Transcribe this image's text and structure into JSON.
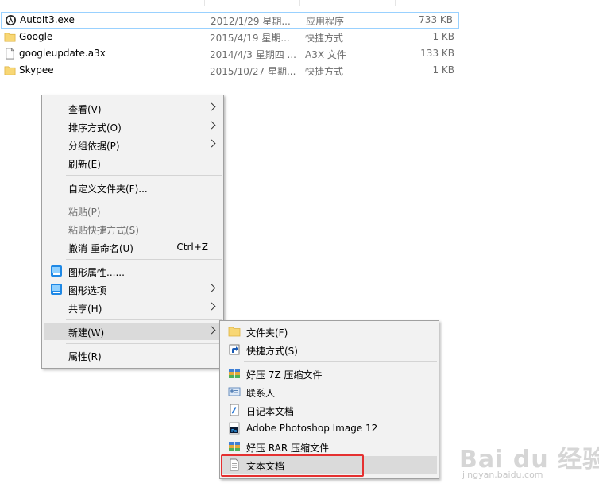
{
  "files": [
    {
      "name": "AutoIt3.exe",
      "date": "2012/1/29 星期...",
      "type": "应用程序",
      "size": "733 KB",
      "icon": "autoit-app-icon",
      "selected": true
    },
    {
      "name": "Google",
      "date": "2015/4/19 星期...",
      "type": "快捷方式",
      "size": "1 KB",
      "icon": "folder-shortcut-icon"
    },
    {
      "name": "googleupdate.a3x",
      "date": "2014/4/3 星期四 ...",
      "type": "A3X 文件",
      "size": "133 KB",
      "icon": "file-icon"
    },
    {
      "name": "Skypee",
      "date": "2015/10/27 星期...",
      "type": "快捷方式",
      "size": "1 KB",
      "icon": "folder-shortcut-icon"
    }
  ],
  "context_menu": {
    "view": "查看(V)",
    "sort_by": "排序方式(O)",
    "group_by": "分组依据(P)",
    "refresh": "刷新(E)",
    "customize_folder": "自定义文件夹(F)...",
    "paste": "粘贴(P)",
    "paste_shortcut": "粘贴快捷方式(S)",
    "undo_rename": "撤消 重命名(U)",
    "undo_shortcut": "Ctrl+Z",
    "graphics_properties": "图形属性......",
    "graphics_options": "图形选项",
    "share": "共享(H)",
    "new": "新建(W)",
    "properties": "属性(R)"
  },
  "new_submenu": {
    "folder": "文件夹(F)",
    "shortcut": "快捷方式(S)",
    "haozip_7z": "好压 7Z 压缩文件",
    "contact": "联系人",
    "journal": "日记本文档",
    "photoshop": "Adobe Photoshop Image 12",
    "haozip_rar": "好压 RAR 压缩文件",
    "text_document": "文本文档"
  },
  "watermark": {
    "brand": "Bai du 经验",
    "url": "jingyan.baidu.com"
  },
  "colors": {
    "menu_bg": "#f2f2f2",
    "menu_highlight": "#dadada",
    "selection_outline": "#99d1ff",
    "annotation_red": "#e53030",
    "folder_yellow": "#f8d775"
  }
}
